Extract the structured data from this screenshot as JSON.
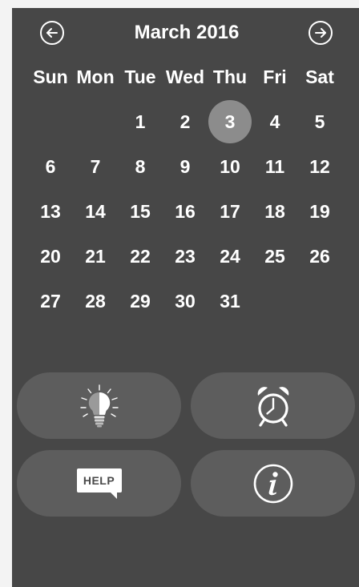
{
  "calendar": {
    "month_title": "March 2016",
    "weekdays": [
      "Sun",
      "Mon",
      "Tue",
      "Wed",
      "Thu",
      "Fri",
      "Sat"
    ],
    "leading_blanks": 2,
    "days_in_month": 31,
    "selected_day": 3,
    "prev_icon": "arrow-left-circle-icon",
    "next_icon": "arrow-right-circle-icon"
  },
  "buttons": [
    {
      "id": "idea",
      "icon": "lightbulb-icon"
    },
    {
      "id": "alarm",
      "icon": "alarm-clock-icon"
    },
    {
      "id": "help",
      "icon": "help-bubble-icon",
      "label": "HELP"
    },
    {
      "id": "info",
      "icon": "info-icon"
    }
  ],
  "colors": {
    "background": "#474747",
    "button": "#5d5d5d",
    "selected_day": "#8c8c8c",
    "text": "#ffffff"
  }
}
